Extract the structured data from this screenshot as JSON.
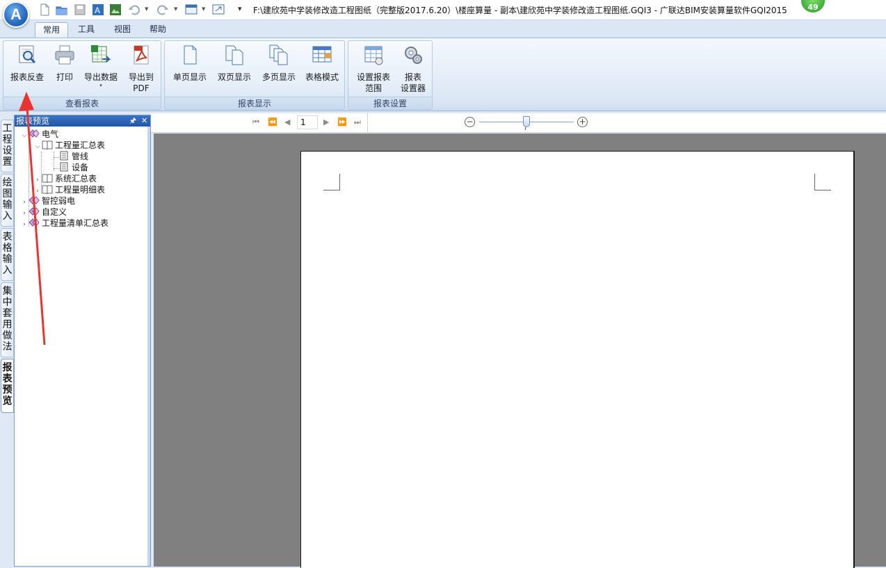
{
  "app": {
    "orb_letter": "A",
    "title": "F:\\建欣苑中学装修改造工程图纸（完整版2017.6.20）\\楼座算量 - 副本\\建欣苑中学装修改造工程图纸.GQI3 - 广联达BIM安装算量软件GQI2015",
    "title_separator": "▾",
    "badge": "49"
  },
  "quick_access": [
    "new-icon",
    "open-icon",
    "save-icon",
    "export-excel-icon",
    "picture-icon",
    "undo-icon",
    "redo-icon",
    "window-icon",
    "restore-icon"
  ],
  "tabs": [
    {
      "label": "常用",
      "active": true
    },
    {
      "label": "工具",
      "active": false
    },
    {
      "label": "视图",
      "active": false
    },
    {
      "label": "帮助",
      "active": false
    }
  ],
  "ribbon": {
    "groups": [
      {
        "label": "查看报表",
        "buttons": [
          {
            "label": "报表反查",
            "icon": "report-reverse-lookup-icon"
          },
          {
            "label": "打印",
            "icon": "printer-icon"
          },
          {
            "label": "导出数据",
            "icon": "export-data-icon",
            "caret": "▾"
          },
          {
            "label1": "导出到",
            "label2": "PDF",
            "icon": "pdf-icon"
          }
        ]
      },
      {
        "label": "报表显示",
        "buttons": [
          {
            "label": "单页显示",
            "icon": "single-page-icon"
          },
          {
            "label": "双页显示",
            "icon": "double-page-icon"
          },
          {
            "label": "多页显示",
            "icon": "multi-page-icon"
          },
          {
            "label": "表格模式",
            "icon": "table-mode-icon"
          }
        ]
      },
      {
        "label": "报表设置",
        "buttons": [
          {
            "label1": "设置报表",
            "label2": "范围",
            "icon": "report-range-icon"
          },
          {
            "label1": "报表",
            "label2": "设置器",
            "icon": "report-settings-icon"
          }
        ]
      }
    ]
  },
  "left_tabs": [
    {
      "chars": [
        "工",
        "程",
        "设",
        "置"
      ],
      "active": false
    },
    {
      "chars": [
        "绘",
        "图",
        "输",
        "入"
      ],
      "active": false
    },
    {
      "chars": [
        "表",
        "格",
        "输",
        "入"
      ],
      "active": false
    },
    {
      "chars": [
        "集",
        "中",
        "套",
        "用",
        "做",
        "法"
      ],
      "active": false
    },
    {
      "chars": [
        "报",
        "表",
        "预",
        "览"
      ],
      "active": true
    }
  ],
  "panel": {
    "title": "报表预览",
    "pin": "🖈",
    "close": "✕",
    "tree": [
      {
        "label": "电气",
        "expander": "⌵",
        "icon": "category-icon"
      },
      {
        "label": "工程量汇总表",
        "expander": "⌵",
        "icon": "book-icon"
      },
      {
        "label": "管线",
        "icon": "report-page-icon"
      },
      {
        "label": "设备",
        "icon": "report-page-icon"
      },
      {
        "label": "系统汇总表",
        "expander": "›",
        "icon": "book-icon"
      },
      {
        "label": "工程量明细表",
        "expander": "›",
        "icon": "book-icon"
      },
      {
        "label": "智控弱电",
        "expander": "›",
        "icon": "category-icon"
      },
      {
        "label": "自定义",
        "expander": "›",
        "icon": "category-icon"
      },
      {
        "label": "工程量清单汇总表",
        "expander": "›",
        "icon": "category-icon"
      }
    ]
  },
  "preview": {
    "nav": {
      "first": "⏮",
      "prev_fast": "⏪",
      "prev": "◀",
      "next": "▶",
      "next_fast": "⏩",
      "last": "⏭"
    },
    "page_number": "1",
    "zoom_out": "−",
    "zoom_in": "+",
    "zoom_level": 0.5
  },
  "colors": {
    "annotation_arrow": "#e8332f",
    "preview_background": "#808080"
  }
}
